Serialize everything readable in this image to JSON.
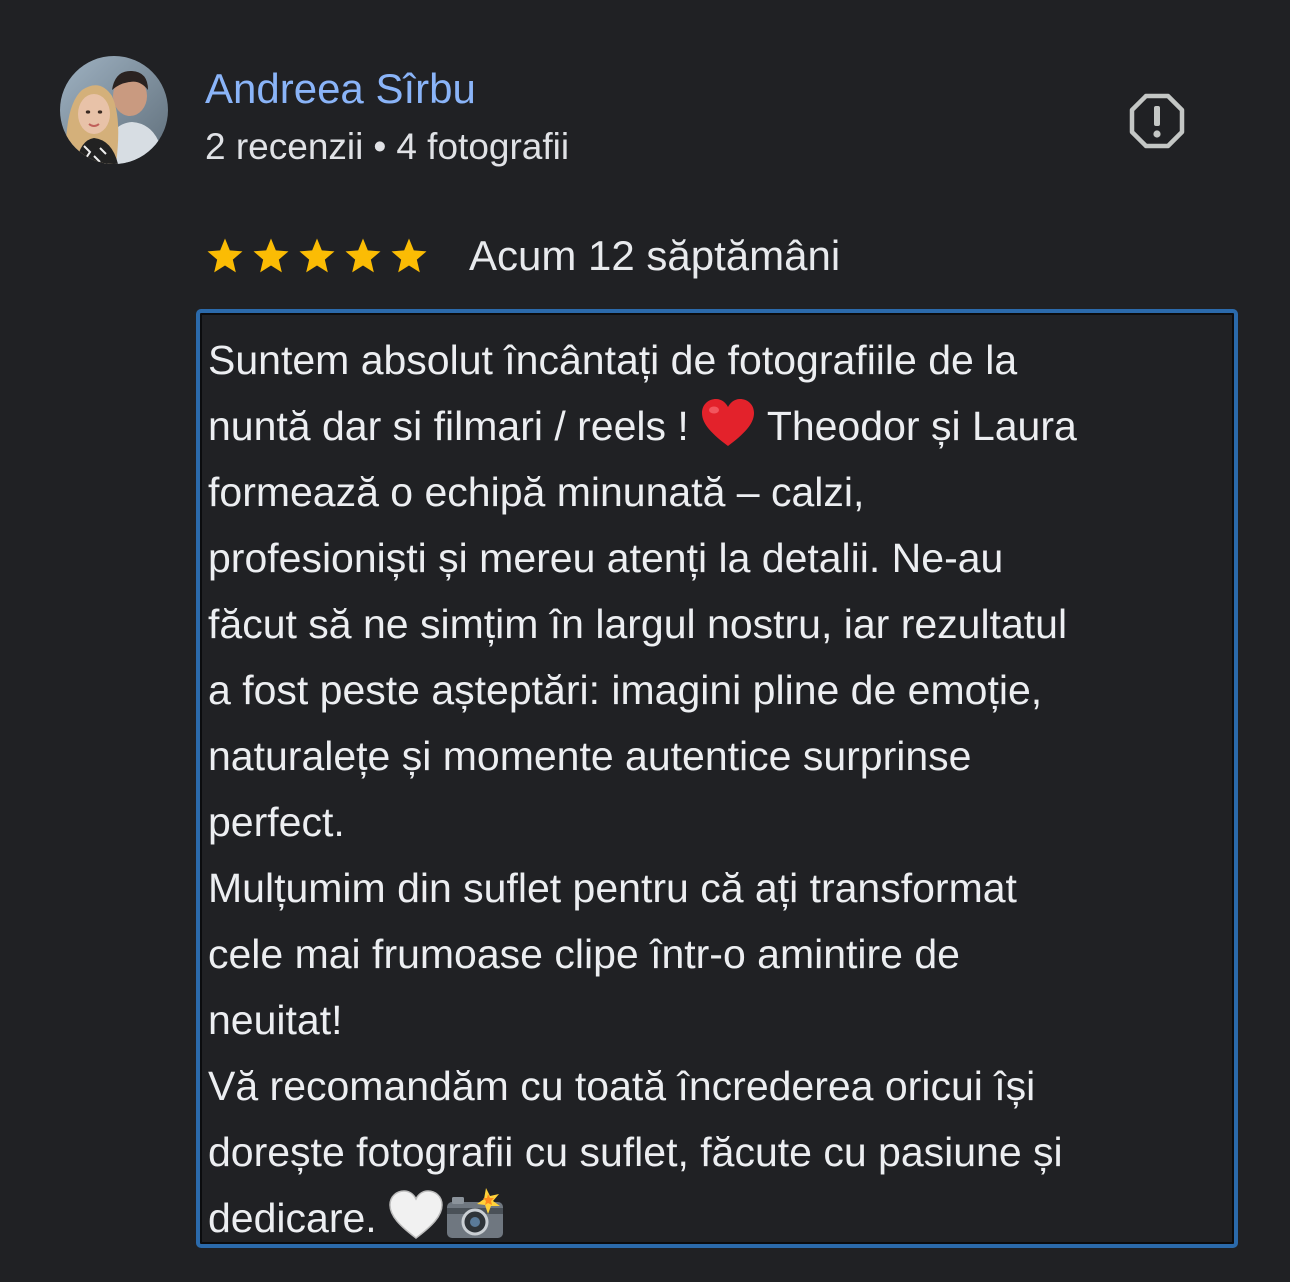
{
  "reviewer": {
    "name": "Andreea Sîrbu",
    "review_count": "2 recenzii",
    "separator": "•",
    "photo_count": "4 fotografii",
    "avatar_icon": "avatar-photo"
  },
  "actions": {
    "report_icon": "report-icon"
  },
  "rating": {
    "value": 5,
    "max": 5,
    "star_color": "#fbbc04",
    "date": "Acum 12 săptămâni"
  },
  "review": {
    "border_color": "#2b6aab",
    "lines": [
      "Suntem absolut încântați de fotografiile de la",
      "nuntă dar si filmari / reels ! ",
      " Theodor și Laura",
      "formează o echipă minunată – calzi,",
      "profesioniști și mereu atenți la detalii. Ne-au",
      "făcut să ne simțim în largul nostru, iar rezultatul",
      "a fost peste așteptări: imagini pline de emoție,",
      "naturalețe și momente autentice surprinse",
      "perfect.",
      "Mulțumim din suflet pentru că ați transformat",
      "cele mai frumoase clipe într-o amintire de",
      "neuitat!",
      "Vă recomandăm cu toată încrederea oricui își",
      "dorește fotografii cu suflet, făcute cu pasiune și",
      "dedicare. "
    ],
    "emojis": [
      "red-heart-emoji",
      "white-heart-emoji",
      "camera-flash-emoji"
    ]
  }
}
